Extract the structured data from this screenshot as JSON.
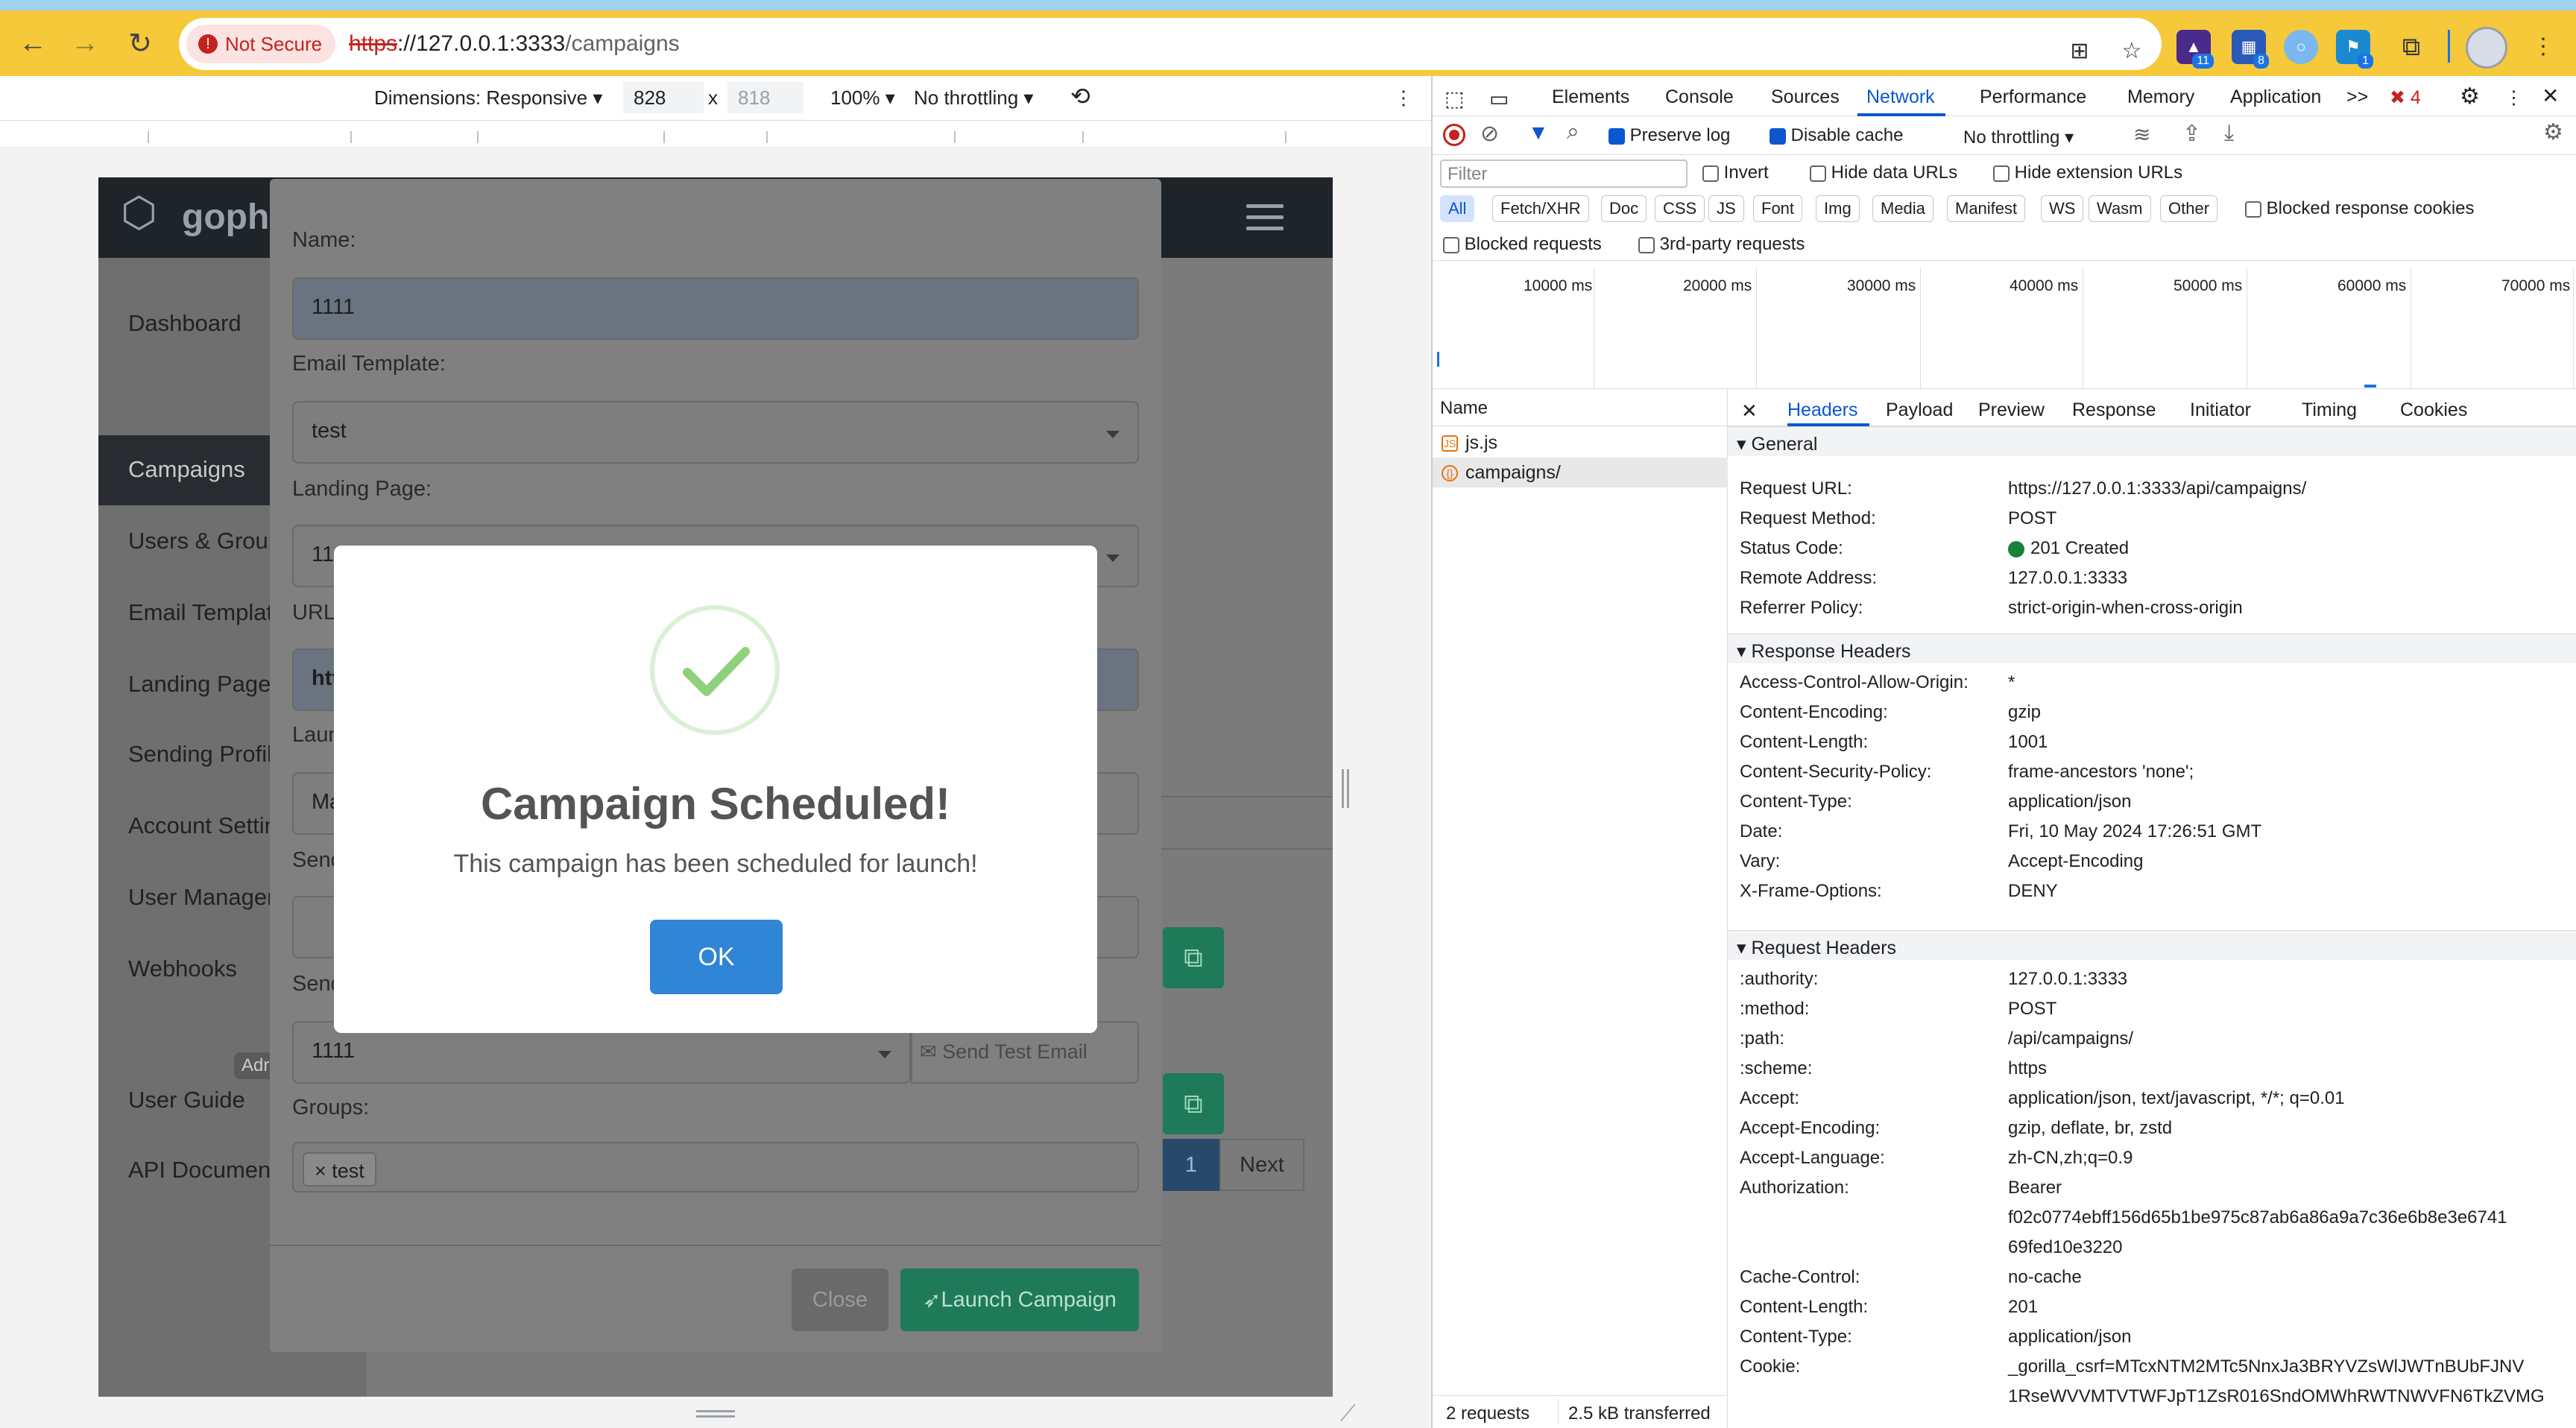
{
  "browser": {
    "security_label": "Not Secure",
    "url_scheme": "https",
    "url_host": "://127.0.0.1:3333",
    "url_path": "/campaigns",
    "extension_badges": [
      "11",
      "8",
      "1"
    ]
  },
  "emulation": {
    "dimensions_label": "Dimensions: Responsive",
    "width": "828",
    "times": "x",
    "height": "818",
    "zoom": "100%",
    "throttling": "No throttling"
  },
  "gophish": {
    "logo_text": "gophi",
    "sidebar": [
      "Dashboard",
      "Campaigns",
      "Users & Group",
      "Email Templat",
      "Landing Pages",
      "Sending Profil",
      "Account Settin",
      "User Managem",
      "Webhooks",
      "User Guide",
      "API Document"
    ],
    "sidebar_badge": "Adr",
    "pager": {
      "page": "1",
      "next": "Next"
    }
  },
  "campaign_modal": {
    "name_label": "Name:",
    "name_value": "1111",
    "template_label": "Email Template:",
    "template_value": "test",
    "landing_label": "Landing Page:",
    "landing_value": "11",
    "url_label": "URL:",
    "url_value": "htt",
    "launch_label": "Laun",
    "launch_value": "Ma",
    "send_label": "Send",
    "sending_label": "Send",
    "profile_value": "1111",
    "send_test_label": "Send Test Email",
    "groups_label": "Groups:",
    "group_tag": "test",
    "close_label": "Close",
    "launch_btn": "Launch Campaign"
  },
  "alert": {
    "title": "Campaign Scheduled!",
    "text": "This campaign has been scheduled for launch!",
    "ok": "OK"
  },
  "devtools": {
    "tabs": [
      "Elements",
      "Console",
      "Sources",
      "Network",
      "Performance",
      "Memory",
      "Application"
    ],
    "more": ">>",
    "error_count": "4",
    "preserve_log": "Preserve log",
    "disable_cache": "Disable cache",
    "throttling": "No throttling",
    "filter_placeholder": "Filter",
    "invert": "Invert",
    "hide_data_urls": "Hide data URLs",
    "hide_ext_urls": "Hide extension URLs",
    "type_filters": [
      "All",
      "Fetch/XHR",
      "Doc",
      "CSS",
      "JS",
      "Font",
      "Img",
      "Media",
      "Manifest",
      "WS",
      "Wasm",
      "Other"
    ],
    "blocked_cookies": "Blocked response cookies",
    "blocked_requests": "Blocked requests",
    "third_party": "3rd-party requests",
    "timeline_labels": [
      "10000 ms",
      "20000 ms",
      "30000 ms",
      "40000 ms",
      "50000 ms",
      "60000 ms",
      "70000 ms"
    ],
    "name_header": "Name",
    "requests": [
      "js.js",
      "campaigns/"
    ],
    "status": {
      "requests": "2 requests",
      "transferred": "2.5 kB transferred"
    },
    "detail_tabs": [
      "Headers",
      "Payload",
      "Preview",
      "Response",
      "Initiator",
      "Timing",
      "Cookies"
    ],
    "general_title": "General",
    "general": [
      {
        "k": "Request URL:",
        "v": "https://127.0.0.1:3333/api/campaigns/"
      },
      {
        "k": "Request Method:",
        "v": "POST"
      },
      {
        "k": "Status Code:",
        "v": "201 Created"
      },
      {
        "k": "Remote Address:",
        "v": "127.0.0.1:3333"
      },
      {
        "k": "Referrer Policy:",
        "v": "strict-origin-when-cross-origin"
      }
    ],
    "response_title": "Response Headers",
    "response": [
      {
        "k": "Access-Control-Allow-Origin:",
        "v": "*"
      },
      {
        "k": "Content-Encoding:",
        "v": "gzip"
      },
      {
        "k": "Content-Length:",
        "v": "1001"
      },
      {
        "k": "Content-Security-Policy:",
        "v": "frame-ancestors 'none';"
      },
      {
        "k": "Content-Type:",
        "v": "application/json"
      },
      {
        "k": "Date:",
        "v": "Fri, 10 May 2024 17:26:51 GMT"
      },
      {
        "k": "Vary:",
        "v": "Accept-Encoding"
      },
      {
        "k": "X-Frame-Options:",
        "v": "DENY"
      }
    ],
    "request_title": "Request Headers",
    "request": [
      {
        "k": ":authority:",
        "v": "127.0.0.1:3333"
      },
      {
        "k": ":method:",
        "v": "POST"
      },
      {
        "k": ":path:",
        "v": "/api/campaigns/"
      },
      {
        "k": ":scheme:",
        "v": "https"
      },
      {
        "k": "Accept:",
        "v": "application/json, text/javascript, */*; q=0.01"
      },
      {
        "k": "Accept-Encoding:",
        "v": "gzip, deflate, br, zstd"
      },
      {
        "k": "Accept-Language:",
        "v": "zh-CN,zh;q=0.9"
      },
      {
        "k": "Authorization:",
        "v": "Bearer"
      },
      {
        "k": "",
        "v": "f02c0774ebff156d65b1be975c87ab6a86a9a7c36e6b8e3e6741"
      },
      {
        "k": "",
        "v": "69fed10e3220"
      },
      {
        "k": "Cache-Control:",
        "v": "no-cache"
      },
      {
        "k": "Content-Length:",
        "v": "201"
      },
      {
        "k": "Content-Type:",
        "v": "application/json"
      },
      {
        "k": "Cookie:",
        "v": "_gorilla_csrf=MTcxNTM2MTc5NnxJa3BRYVZsWlJWTnBUbFJNV"
      },
      {
        "k": "",
        "v": "1RseWVVMTVTWFJpT1ZsR016SndOMWhRWTNWVFN6TkZVMG"
      }
    ]
  },
  "colors": {
    "chrome": "#f6c93a",
    "accent": "#0b57d0",
    "ok_button": "#3085d6",
    "highlight_box": "#e8141e"
  }
}
